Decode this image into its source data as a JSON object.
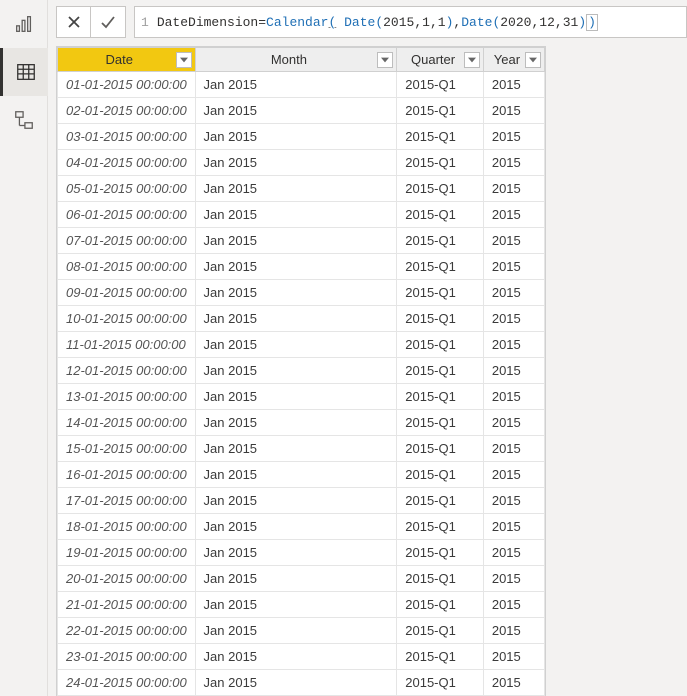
{
  "formula": {
    "line_number": "1",
    "table_name": "DateDimension",
    "eq": " = ",
    "fn_calendar": "Calendar",
    "fn_date": "Date",
    "args1": [
      "2015",
      "1",
      "1"
    ],
    "args2": [
      "2020",
      "12",
      "31"
    ]
  },
  "columns": [
    {
      "label": "Date",
      "key": true
    },
    {
      "label": "Month",
      "key": false
    },
    {
      "label": "Quarter",
      "key": false
    },
    {
      "label": "Year",
      "key": false
    }
  ],
  "rows": [
    [
      "01-01-2015 00:00:00",
      "Jan 2015",
      "2015-Q1",
      "2015"
    ],
    [
      "02-01-2015 00:00:00",
      "Jan 2015",
      "2015-Q1",
      "2015"
    ],
    [
      "03-01-2015 00:00:00",
      "Jan 2015",
      "2015-Q1",
      "2015"
    ],
    [
      "04-01-2015 00:00:00",
      "Jan 2015",
      "2015-Q1",
      "2015"
    ],
    [
      "05-01-2015 00:00:00",
      "Jan 2015",
      "2015-Q1",
      "2015"
    ],
    [
      "06-01-2015 00:00:00",
      "Jan 2015",
      "2015-Q1",
      "2015"
    ],
    [
      "07-01-2015 00:00:00",
      "Jan 2015",
      "2015-Q1",
      "2015"
    ],
    [
      "08-01-2015 00:00:00",
      "Jan 2015",
      "2015-Q1",
      "2015"
    ],
    [
      "09-01-2015 00:00:00",
      "Jan 2015",
      "2015-Q1",
      "2015"
    ],
    [
      "10-01-2015 00:00:00",
      "Jan 2015",
      "2015-Q1",
      "2015"
    ],
    [
      "11-01-2015 00:00:00",
      "Jan 2015",
      "2015-Q1",
      "2015"
    ],
    [
      "12-01-2015 00:00:00",
      "Jan 2015",
      "2015-Q1",
      "2015"
    ],
    [
      "13-01-2015 00:00:00",
      "Jan 2015",
      "2015-Q1",
      "2015"
    ],
    [
      "14-01-2015 00:00:00",
      "Jan 2015",
      "2015-Q1",
      "2015"
    ],
    [
      "15-01-2015 00:00:00",
      "Jan 2015",
      "2015-Q1",
      "2015"
    ],
    [
      "16-01-2015 00:00:00",
      "Jan 2015",
      "2015-Q1",
      "2015"
    ],
    [
      "17-01-2015 00:00:00",
      "Jan 2015",
      "2015-Q1",
      "2015"
    ],
    [
      "18-01-2015 00:00:00",
      "Jan 2015",
      "2015-Q1",
      "2015"
    ],
    [
      "19-01-2015 00:00:00",
      "Jan 2015",
      "2015-Q1",
      "2015"
    ],
    [
      "20-01-2015 00:00:00",
      "Jan 2015",
      "2015-Q1",
      "2015"
    ],
    [
      "21-01-2015 00:00:00",
      "Jan 2015",
      "2015-Q1",
      "2015"
    ],
    [
      "22-01-2015 00:00:00",
      "Jan 2015",
      "2015-Q1",
      "2015"
    ],
    [
      "23-01-2015 00:00:00",
      "Jan 2015",
      "2015-Q1",
      "2015"
    ],
    [
      "24-01-2015 00:00:00",
      "Jan 2015",
      "2015-Q1",
      "2015"
    ]
  ]
}
